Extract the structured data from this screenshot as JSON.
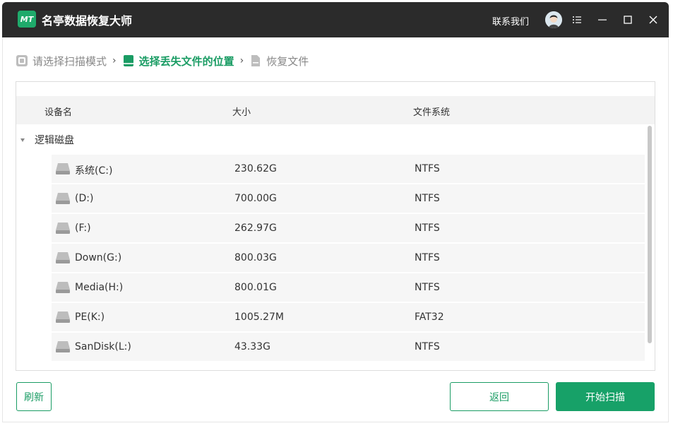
{
  "app": {
    "title": "名亭数据恢复大师",
    "logo_text": "MT",
    "contact_label": "联系我们"
  },
  "breadcrumb": {
    "steps": [
      {
        "label": "请选择扫描模式",
        "icon": "scan-mode-icon",
        "state": "inactive"
      },
      {
        "label": "选择丢失文件的位置",
        "icon": "folder-location-icon",
        "state": "active"
      },
      {
        "label": "恢复文件",
        "icon": "recover-file-icon",
        "state": "inactive"
      }
    ],
    "separator": "›"
  },
  "table": {
    "columns": [
      "设备名",
      "大小",
      "文件系统"
    ],
    "group_label": "逻辑磁盘",
    "rows": [
      {
        "name": "系统(C:)",
        "size": "230.62G",
        "fs": "NTFS"
      },
      {
        "name": "(D:)",
        "size": "700.00G",
        "fs": "NTFS"
      },
      {
        "name": "(F:)",
        "size": "262.97G",
        "fs": "NTFS"
      },
      {
        "name": "Down(G:)",
        "size": "800.03G",
        "fs": "NTFS"
      },
      {
        "name": "Media(H:)",
        "size": "800.01G",
        "fs": "NTFS"
      },
      {
        "name": "PE(K:)",
        "size": "1005.27M",
        "fs": "FAT32"
      },
      {
        "name": "SanDisk(L:)",
        "size": "43.33G",
        "fs": "NTFS"
      }
    ]
  },
  "buttons": {
    "refresh": "刷新",
    "back": "返回",
    "start_scan": "开始扫描"
  },
  "colors": {
    "accent": "#1a9c64",
    "titlebar": "#2b2b2b"
  }
}
